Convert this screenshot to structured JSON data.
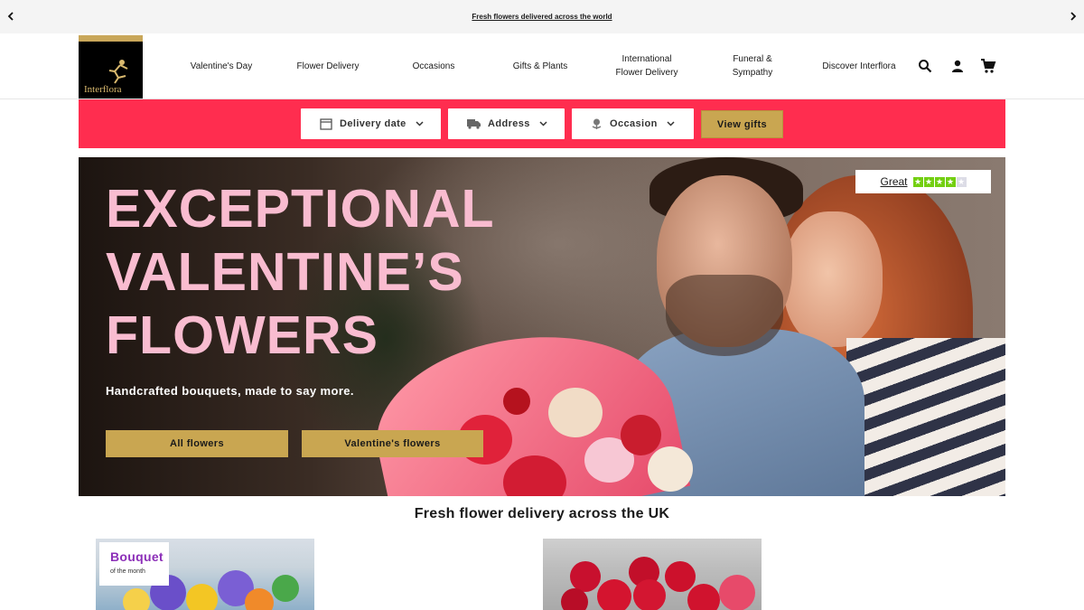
{
  "announcement": {
    "text": "Fresh flowers delivered across the world"
  },
  "brand": {
    "logo_text": "Interflora",
    "colors": {
      "gold": "#c9a651",
      "band": "#ff2d4f",
      "headline": "#f9bcd0",
      "badge_purple": "#8c2fb8"
    }
  },
  "nav": {
    "items": [
      {
        "label": "Valentine's Day"
      },
      {
        "label": "Flower Delivery"
      },
      {
        "label": "Occasions"
      },
      {
        "label": "Gifts & Plants"
      },
      {
        "label": "International Flower Delivery"
      },
      {
        "label": "Funeral & Sympathy"
      },
      {
        "label": "Discover Interflora"
      }
    ],
    "icons": [
      "search-icon",
      "account-icon",
      "cart-icon"
    ]
  },
  "finder": {
    "delivery_date": "Delivery date",
    "address": "Address",
    "occasion": "Occasion",
    "submit": "View gifts"
  },
  "hero": {
    "title_line1": "EXCEPTIONAL",
    "title_line2": "VALENTINE’S",
    "title_line3": "FLOWERS",
    "subtitle": "Handcrafted bouquets, made to say more.",
    "button_primary": "All flowers",
    "button_secondary": "Valentine's flowers",
    "trust_label": "Great",
    "trust_stars": 4,
    "trust_stars_max": 5
  },
  "section": {
    "title": "Fresh flower delivery across the UK"
  },
  "cards": [
    {
      "badge_title": "Bouquet",
      "badge_sub": "of the month"
    },
    {}
  ]
}
